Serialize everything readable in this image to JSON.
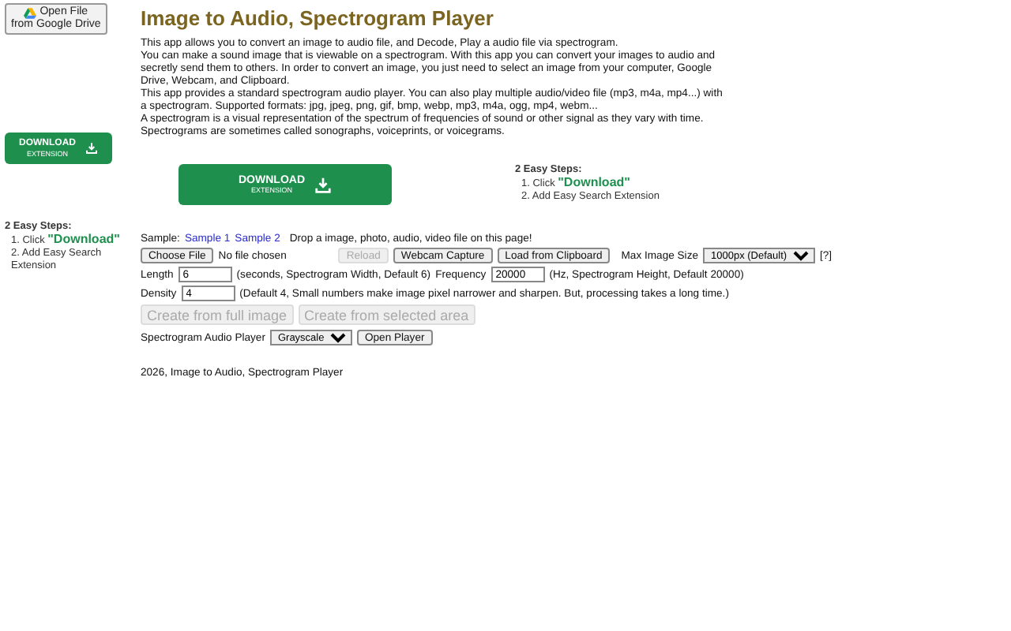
{
  "drive_button": {
    "lines": [
      "Open File",
      "from Google Drive"
    ]
  },
  "title": "Image to Audio, Spectrogram Player",
  "description": [
    "This app allows you to convert an image to audio file, and Decode, Play a audio file via spectrogram.",
    "You can make a sound image that is viewable on a spectrogram. With this app you can convert your images to audio and",
    "secretly send them to others. In order to convert an image, you just need to select an image from your computer, Google",
    "Drive, Webcam, and Clipboard.",
    "This app provides a standard spectrogram audio player. You can also play multiple audio/video file (mp3, m4a, mp4...) with",
    "a spectrogram. Supported formats: jpg, jpeg, png, gif, bmp, webp, mp3, m4a, ogg, mp4, webm...",
    "A spectrogram is a visual representation of the spectrum of frequencies of sound or other signal as they vary with time.",
    "Spectrograms are sometimes called sonographs, voiceprints, or voicegrams."
  ],
  "banner": {
    "label": "DOWNLOAD",
    "sublabel": "EXTENSION"
  },
  "steps_top": {
    "heading": "2 Easy Steps:",
    "items": [
      {
        "number": "1.",
        "text": "Click",
        "highlight": "\"Download\""
      },
      {
        "number": "2.",
        "text": "Add Easy Search Extension"
      }
    ]
  },
  "side_banner": {
    "label": "DOWNLOAD",
    "sublabel": "EXTENSION"
  },
  "steps_side": {
    "heading": "2 Easy Steps:",
    "items": [
      {
        "number": "1.",
        "text": "Click",
        "highlight": "\"Download\""
      },
      {
        "number": "2.",
        "text": "Add Easy Search Extension"
      }
    ]
  },
  "sample": {
    "label": "Sample:",
    "links": [
      "Sample 1",
      "Sample 2"
    ],
    "hint": "Drop a image, photo, audio, video file on this page!"
  },
  "file_row": {
    "choose": "Choose File",
    "chosen": "No file chosen",
    "reload": {
      "label": "Reload",
      "disabled": true
    },
    "webcam": "Webcam Capture",
    "clipboard": "Load from Clipboard",
    "size_label": "Max Image Size",
    "size_value": "1000px (Default)",
    "help": "[?]"
  },
  "length": {
    "label": "Length",
    "value": "6",
    "note": "(seconds, Spectrogram Width, Default 6)"
  },
  "frequency": {
    "label": "Frequency",
    "value": "20000",
    "note": "(Hz, Spectrogram Height, Default 20000)"
  },
  "density": {
    "label": "Density",
    "value": "4",
    "note": "(Default 4, Small numbers make image pixel narrower and sharpen. But, processing takes a long time.)"
  },
  "create_buttons": [
    {
      "label": "Create from full image",
      "disabled": true
    },
    {
      "label": "Create from selected area",
      "disabled": true
    }
  ],
  "player": {
    "label": "Spectrogram Audio Player",
    "mode": "Grayscale",
    "open": "Open Player"
  },
  "footer": "2026, Image to Audio, Spectrogram Player"
}
